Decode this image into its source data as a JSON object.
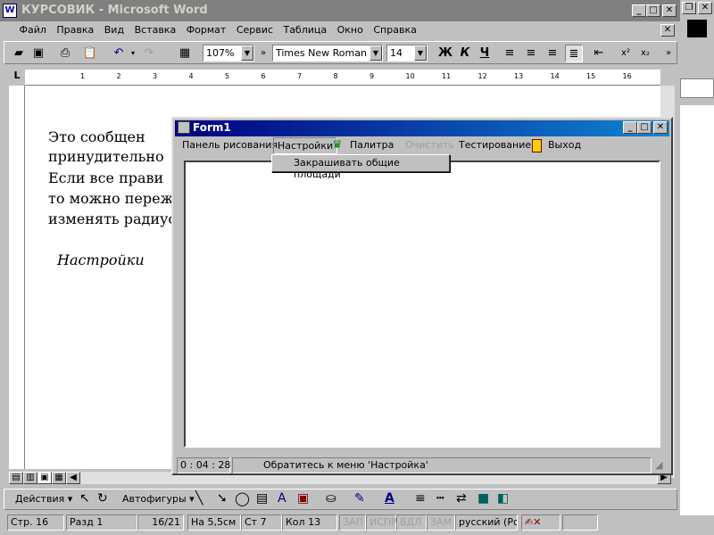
{
  "word": {
    "title": "КУРСОВИК - Microsoft Word",
    "menu": [
      "Файл",
      "Правка",
      "Вид",
      "Вставка",
      "Формат",
      "Сервис",
      "Таблица",
      "Окно",
      "Справка"
    ],
    "zoom": "107%",
    "font": "Times New Roman",
    "size": "14",
    "bold": "Ж",
    "italic": "К",
    "underline": "Ч",
    "ruler_marks": [
      "1",
      "2",
      "3",
      "4",
      "5",
      "6",
      "7",
      "8",
      "9",
      "10",
      "11",
      "12",
      "13",
      "14",
      "15",
      "16"
    ],
    "doc_lines": [
      "Это    сообщен",
      "принудительно ",
      "Если все прави",
      "то можно переж",
      "изменять радиус",
      "Настройки"
    ],
    "draw_toolbar": {
      "actions": "Действия",
      "autoshapes": "Автофигуры"
    },
    "status": {
      "page": "Стр.  16",
      "section": "Разд  1",
      "pages": "16/21",
      "at": "На 5,5см",
      "line": "Ст  7",
      "col": "Кол  13",
      "rec": "ЗАП",
      "trk": "ИСПР",
      "ext": "ВДЛ",
      "ovr": "ЗАМ",
      "lang": "русский (Ро"
    }
  },
  "form": {
    "title": "Form1",
    "menu": {
      "draw_panel": "Панель рисования",
      "settings": "Настройки",
      "palette": "Палитра",
      "clear": "Очистить",
      "testing": "Тестирование",
      "exit": "Выход"
    },
    "dropdown_item": "Закрашивать общие площади",
    "timer": "0 : 04 : 28",
    "status_message": "Обратитесь к меню 'Настройка'"
  },
  "colors": {
    "titlebar_active": "#000080",
    "titlebar_inactive": "#808080"
  }
}
